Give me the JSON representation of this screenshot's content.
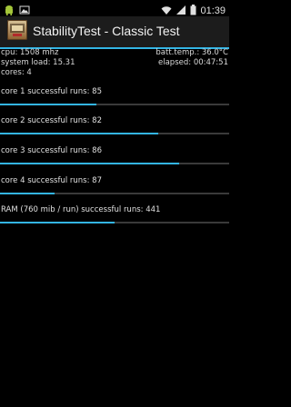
{
  "status_bar": {
    "time": "01:39",
    "icons": [
      "android-icon",
      "image-icon",
      "wifi-icon",
      "signal-icon",
      "battery-icon"
    ]
  },
  "app": {
    "title": "StabilityTest - Classic Test",
    "icon": "app-icon"
  },
  "info": {
    "cpu": "cpu: 1508 mhz",
    "batt_temp": "batt.temp.: 36.0°C",
    "system_load": "system load: 15.31",
    "elapsed": "elapsed: 00:47:51",
    "cores": "cores: 4"
  },
  "tests": [
    {
      "label": "core 1 successful runs: 85",
      "progress": 0.42
    },
    {
      "label": "core 2 successful runs: 82",
      "progress": 0.69
    },
    {
      "label": "core 3 successful runs: 86",
      "progress": 0.78
    },
    {
      "label": "core 4 successful runs: 87",
      "progress": 0.24
    },
    {
      "label": "RAM (760 mib / run) successful runs: 441",
      "progress": 0.5
    }
  ],
  "colors": {
    "accent": "#33b5e5",
    "background": "#000000",
    "action_bar": "#1c1c1c"
  }
}
